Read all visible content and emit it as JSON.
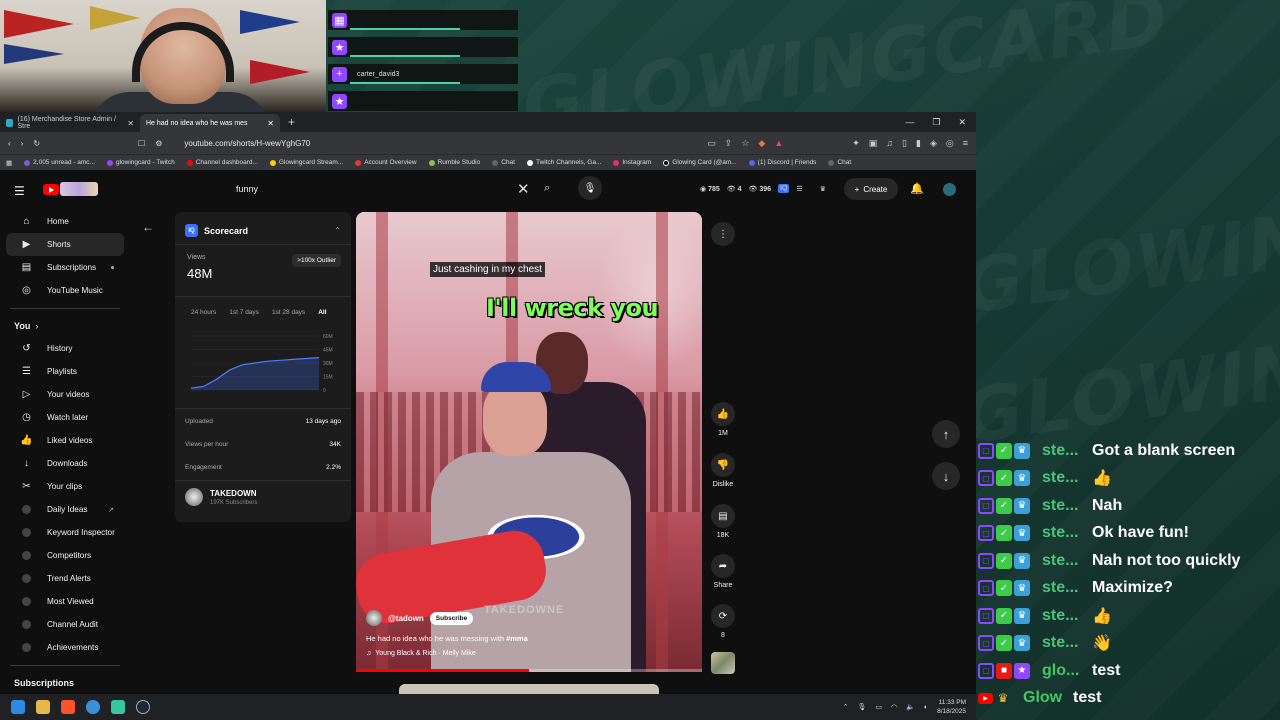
{
  "overlay": {
    "bg_word": "GLOWINGCARD",
    "alerts": [
      {
        "icon": "gift-icon",
        "text": ""
      },
      {
        "icon": "star-icon",
        "text": ""
      },
      {
        "icon": "plus-icon",
        "text": "carter_david3"
      },
      {
        "icon": "star-icon",
        "text": ""
      }
    ]
  },
  "browser": {
    "tabs": [
      {
        "title": "(16) Merchandise Store Admin / Stre",
        "active": false
      },
      {
        "title": "He had no idea who he was mes",
        "active": true
      }
    ],
    "url": "youtube.com/shorts/H-wewYghG70",
    "bookmarks": [
      "2,005 unread - amc...",
      "glowingcard - Twitch",
      "Channel dashboard...",
      "Glowingcard Stream...",
      "Account Overview",
      "Rumble Studio",
      "Chat",
      "Twitch Channels, Ga...",
      "Instagram",
      "Glowing Card (@am...",
      "(1) Discord | Friends",
      "Chat"
    ]
  },
  "youtube": {
    "search_value": "funny",
    "stats": {
      "a": "785",
      "b": "4",
      "c": "396"
    },
    "create_label": "Create",
    "sidebar": {
      "main": [
        {
          "label": "Home",
          "icon": "home-icon"
        },
        {
          "label": "Shorts",
          "icon": "shorts-icon"
        },
        {
          "label": "Subscriptions",
          "icon": "subscriptions-icon"
        },
        {
          "label": "YouTube Music",
          "icon": "music-icon"
        }
      ],
      "you_heading": "You",
      "you": [
        {
          "label": "History",
          "icon": "history-icon"
        },
        {
          "label": "Playlists",
          "icon": "playlist-icon"
        },
        {
          "label": "Your videos",
          "icon": "video-icon"
        },
        {
          "label": "Watch later",
          "icon": "clock-icon"
        },
        {
          "label": "Liked videos",
          "icon": "like-icon"
        },
        {
          "label": "Downloads",
          "icon": "download-icon"
        },
        {
          "label": "Your clips",
          "icon": "scissors-icon"
        }
      ],
      "tools": [
        "Daily Ideas",
        "Keyword Inspector",
        "Competitors",
        "Trend Alerts",
        "Most Viewed",
        "Channel Audit",
        "Achievements"
      ],
      "subscriptions_heading": "Subscriptions"
    },
    "scorecard": {
      "title": "Scorecard",
      "views_label": "Views",
      "views": "48M",
      "badge": ">100x Outlier",
      "ranges": [
        "24 hours",
        "1st 7 days",
        "1st 28 days",
        "All"
      ],
      "chart": {
        "y_ticks": [
          "60M",
          "45M",
          "30M",
          "15M",
          "0"
        ],
        "ymax": 60,
        "points": [
          2,
          4,
          12,
          22,
          28,
          30,
          32,
          33,
          34,
          35,
          36
        ]
      },
      "rows": [
        {
          "label": "Uploaded",
          "value": "13 days ago"
        },
        {
          "label": "Views per hour",
          "value": "34K"
        },
        {
          "label": "Engagement",
          "value": "2.2%"
        }
      ],
      "channel_name": "TAKEDOWN",
      "channel_subs": "197K Subscribers"
    },
    "short": {
      "caption_small": "Just cashing in my chest",
      "caption_big": "I'll wreck you",
      "watermark": "TAKEDOWNE",
      "channel": "@tadown",
      "subscribe_label": "Subscribe",
      "title": "He had no idea who he was messing with",
      "hashtag": "#mma",
      "music": "Young Black & Rich · Melly Mike",
      "progress": 0.5
    },
    "actions": [
      {
        "icon": "like-icon",
        "label": "1M"
      },
      {
        "icon": "dislike-icon",
        "label": "Dislike"
      },
      {
        "icon": "comment-icon",
        "label": "18K"
      },
      {
        "icon": "share-icon",
        "label": "Share"
      },
      {
        "icon": "remix-icon",
        "label": "8"
      }
    ]
  },
  "taskbar": {
    "time": "11:33 PM",
    "date": "8/18/2025"
  },
  "chat": [
    {
      "badges": [
        "twitch",
        "check",
        "crown"
      ],
      "user": "ste...",
      "text": "Got a blank screen"
    },
    {
      "badges": [
        "twitch",
        "check",
        "crown"
      ],
      "user": "ste...",
      "text": "👍"
    },
    {
      "badges": [
        "twitch",
        "check",
        "crown"
      ],
      "user": "ste...",
      "text": "Nah"
    },
    {
      "badges": [
        "twitch",
        "check",
        "crown"
      ],
      "user": "ste...",
      "text": "Ok have fun!"
    },
    {
      "badges": [
        "twitch",
        "check",
        "crown"
      ],
      "user": "ste...",
      "text": "Nah not too quickly"
    },
    {
      "badges": [
        "twitch",
        "check",
        "crown"
      ],
      "user": "ste...",
      "text": "Maximize?"
    },
    {
      "badges": [
        "twitch",
        "check",
        "crown"
      ],
      "user": "ste...",
      "text": "👍"
    },
    {
      "badges": [
        "twitch",
        "check",
        "crown"
      ],
      "user": "ste...",
      "text": "👋"
    },
    {
      "badges": [
        "twitch",
        "cam",
        "star"
      ],
      "user": "glo...",
      "text": "test"
    },
    {
      "badges": [
        "yt",
        "gold"
      ],
      "user": "Glowi...",
      "text": "test"
    }
  ]
}
